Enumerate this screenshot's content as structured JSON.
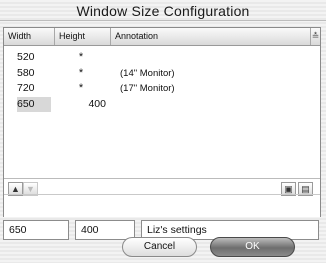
{
  "window": {
    "title": "Window Size Configuration"
  },
  "table": {
    "columns": [
      "Width",
      "Height",
      "Annotation"
    ],
    "rows": [
      {
        "width": "520",
        "height": "*",
        "annotation": ""
      },
      {
        "width": "580",
        "height": "*",
        "annotation": "(14\" Monitor)"
      },
      {
        "width": "720",
        "height": "*",
        "annotation": "(17\" Monitor)"
      },
      {
        "width": "650",
        "height": "400",
        "annotation": ""
      }
    ],
    "selected_row": 3
  },
  "toolbar": {
    "move_up_icon": "arrow-up-icon",
    "move_down_icon": "arrow-down-icon",
    "save_icon": "save-icon",
    "delete_icon": "trash-icon"
  },
  "form": {
    "width_value": "650",
    "height_value": "400",
    "annotation_value": "Liz's settings"
  },
  "buttons": {
    "cancel": "Cancel",
    "ok": "OK"
  }
}
